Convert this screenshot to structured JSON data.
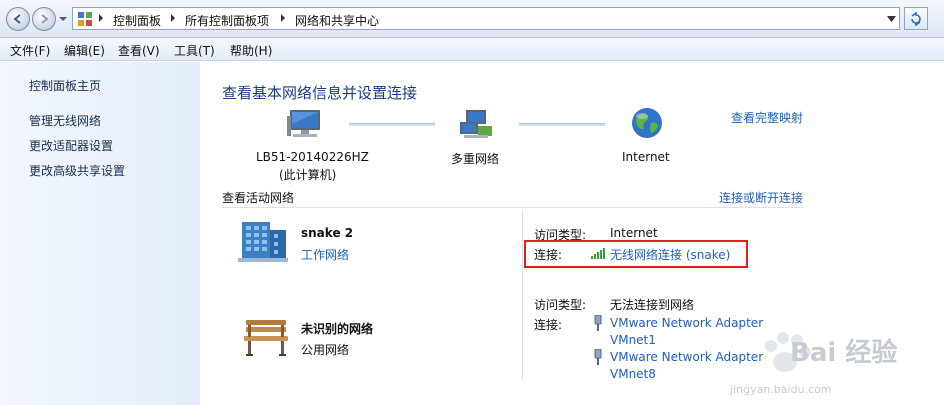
{
  "address": {
    "breadcrumbs": [
      "控制面板",
      "所有控制面板项",
      "网络和共享中心"
    ]
  },
  "menu": [
    "文件(F)",
    "编辑(E)",
    "查看(V)",
    "工具(T)",
    "帮助(H)"
  ],
  "left_pane": {
    "items": [
      "控制面板主页",
      "管理无线网络",
      "更改适配器设置",
      "更改高级共享设置"
    ]
  },
  "main": {
    "title": "查看基本网络信息并设置连接",
    "full_map_link": "查看完整映射",
    "nodes": [
      {
        "label": "LB51-20140226HZ",
        "sublabel": "(此计算机)"
      },
      {
        "label": "多重网络"
      },
      {
        "label": "Internet"
      }
    ],
    "active_networks_heading": "查看活动网络",
    "connect_link": "连接或断开连接",
    "networks": [
      {
        "name": "snake  2",
        "type": "工作网络",
        "type_is_link": true,
        "access_label": "访问类型:",
        "access_value": "Internet",
        "connection_label": "连接:",
        "connections": [
          "无线网络连接 (snake)"
        ]
      },
      {
        "name": "未识别的网络",
        "type": "公用网络",
        "type_is_link": false,
        "access_label": "访问类型:",
        "access_value": "无法连接到网络",
        "connection_label": "连接:",
        "connections": [
          "VMware Network Adapter",
          "VMnet1",
          "VMware Network Adapter",
          "VMnet8"
        ]
      }
    ]
  },
  "watermark": {
    "text": "Bai 经验",
    "url": "jingyan.baidu.com"
  },
  "colors": {
    "link": "#1f5fbf",
    "title": "#1e3a8a",
    "highlight": "#e0201e"
  }
}
